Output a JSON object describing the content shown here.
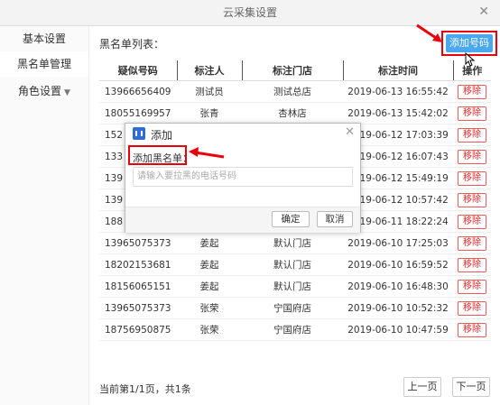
{
  "window": {
    "title": "云采集设置",
    "close_glyph": "✕"
  },
  "sidebar": {
    "items": [
      {
        "label": "基本设置"
      },
      {
        "label": "黑名单管理"
      },
      {
        "label": "角色设置",
        "caret": "▼"
      }
    ]
  },
  "main": {
    "list_title": "黑名单列表：",
    "add_button": "添加号码",
    "columns": [
      "疑似号码",
      "标注人",
      "标注门店",
      "标注时间",
      "操作"
    ],
    "rows": [
      {
        "phone": "13966656409",
        "person": "测试员",
        "store": "测试总店",
        "time": "2019-06-13 16:55:42",
        "action": "移除"
      },
      {
        "phone": "18055169957",
        "person": "张青",
        "store": "杏林店",
        "time": "2019-06-13 15:42:02",
        "action": "移除"
      },
      {
        "phone": "152",
        "person": "",
        "store": "",
        "time": "2019-06-12 17:03:39",
        "action": "移除"
      },
      {
        "phone": "133",
        "person": "",
        "store": "",
        "time": "2019-06-12 16:07:43",
        "action": "移除"
      },
      {
        "phone": "139",
        "person": "",
        "store": "",
        "time": "2019-06-12 15:49:19",
        "action": "移除"
      },
      {
        "phone": "139",
        "person": "",
        "store": "",
        "time": "2019-06-12 10:57:42",
        "action": "移除"
      },
      {
        "phone": "188",
        "person": "",
        "store": "",
        "time": "2019-06-11 18:22:24",
        "action": "移除"
      },
      {
        "phone": "13965075373",
        "person": "姜起",
        "store": "默认门店",
        "time": "2019-06-10 17:25:03",
        "action": "移除"
      },
      {
        "phone": "18202153681",
        "person": "姜起",
        "store": "默认门店",
        "time": "2019-06-10 16:59:52",
        "action": "移除"
      },
      {
        "phone": "18156065151",
        "person": "姜起",
        "store": "默认门店",
        "time": "2019-06-10 16:48:30",
        "action": "移除"
      },
      {
        "phone": "13965075373",
        "person": "张荣",
        "store": "宁国府店",
        "time": "2019-06-10 10:52:32",
        "action": "移除"
      },
      {
        "phone": "18756950875",
        "person": "张荣",
        "store": "宁国府店",
        "time": "2019-06-10 10:47:59",
        "action": "移除"
      }
    ],
    "pager": {
      "text": "当前第1/1页，共1条",
      "prev": "上一页",
      "next": "下一页"
    }
  },
  "dialog": {
    "title": "添加",
    "close_glyph": "✕",
    "label": "添加黑名单：",
    "input_placeholder": "请输入要拉黑的电话号码",
    "confirm": "确定",
    "cancel": "取消"
  },
  "colors": {
    "accent": "#4aa8ef",
    "annotation": "#e8000b",
    "danger": "#e0292c"
  }
}
